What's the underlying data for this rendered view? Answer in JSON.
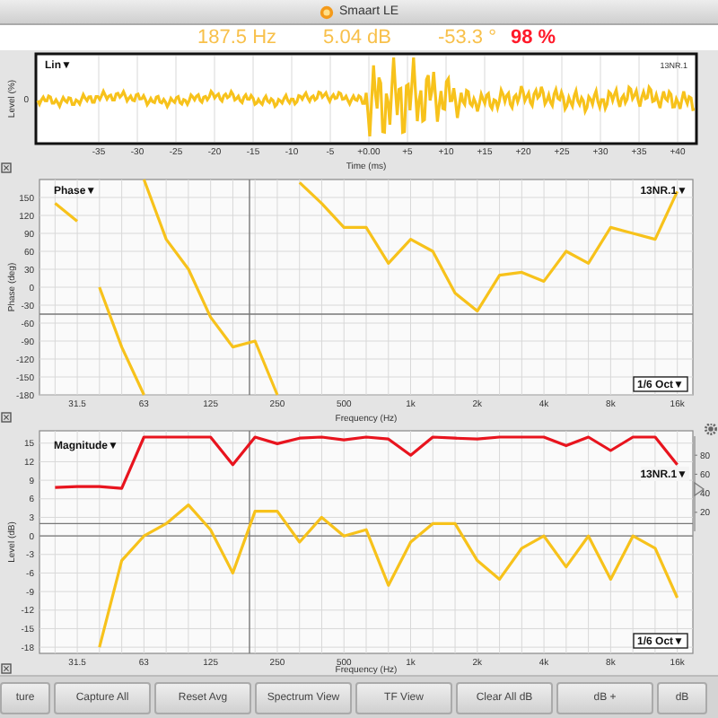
{
  "window": {
    "title": "Smaart LE"
  },
  "readouts": [
    {
      "text": "187.5 Hz",
      "color": "#f8c04a"
    },
    {
      "text": "5.04 dB",
      "color": "#f8c04a"
    },
    {
      "text": "-53.3 °",
      "color": "#f8c04a"
    },
    {
      "text": "98 %",
      "color": "#ff1a2a"
    }
  ],
  "time_plot": {
    "mode": "Lin▼",
    "trace_label": "13NR.1",
    "ylabel": "Level (%)",
    "yticks": [
      "0"
    ],
    "xlabel": "Time (ms)",
    "xticks": [
      "-35",
      "-30",
      "-25",
      "-20",
      "-15",
      "-10",
      "-5",
      "+0.00",
      "+5",
      "+10",
      "+15",
      "+20",
      "+25",
      "+30",
      "+35",
      "+40"
    ]
  },
  "phase_plot": {
    "mode": "Phase▼",
    "trace_label": "13NR.1▼",
    "smoothing": "1/6 Oct▼",
    "chart_data": {
      "type": "line",
      "xlabel": "Frequency (Hz)",
      "ylabel": "Phase (deg)",
      "categories": [
        null,
        "31.5",
        null,
        null,
        "63",
        null,
        null,
        "125",
        null,
        null,
        "250",
        null,
        null,
        "500",
        null,
        null,
        "1k",
        null,
        null,
        "2k",
        null,
        null,
        "4k",
        null,
        null,
        "8k",
        null,
        null,
        "16k"
      ],
      "series": [
        {
          "color": "#f7c21b",
          "values": [
            140,
            110,
            null,
            null,
            null,
            null,
            null,
            null,
            null,
            null,
            null,
            null,
            null,
            null,
            null,
            null,
            null,
            null,
            null,
            null,
            null,
            null,
            null,
            null,
            null,
            null,
            null,
            null,
            null
          ]
        },
        {
          "color": "#f7c21b",
          "values": [
            null,
            null,
            0,
            -100,
            -180,
            null,
            null,
            null,
            null,
            null,
            null,
            null,
            null,
            null,
            null,
            null,
            null,
            null,
            null,
            null,
            null,
            null,
            null,
            null,
            null,
            null,
            null,
            null,
            null
          ]
        },
        {
          "color": "#f7c21b",
          "values": [
            null,
            null,
            null,
            null,
            180,
            80,
            30,
            -50,
            -100,
            -90,
            -180,
            null,
            null,
            null,
            null,
            null,
            null,
            null,
            null,
            null,
            null,
            null,
            null,
            null,
            null,
            null,
            null,
            null,
            null
          ]
        },
        {
          "color": "#f7c21b",
          "values": [
            null,
            null,
            null,
            null,
            null,
            null,
            null,
            null,
            null,
            null,
            null,
            175,
            140,
            100,
            100,
            40,
            80,
            60,
            -10,
            -40,
            20,
            25,
            10,
            60,
            40,
            100,
            90,
            80,
            160
          ]
        }
      ],
      "ylim": [
        -180,
        180
      ],
      "grid": true,
      "ref_lines": [
        {
          "axis": "y",
          "value": -45
        }
      ],
      "yticks": [
        150,
        120,
        90,
        60,
        30,
        0,
        -30,
        -60,
        -90,
        -120,
        -150,
        -180
      ]
    }
  },
  "magnitude_plot": {
    "mode": "Magnitude▼",
    "trace_label": "13NR.1▼",
    "smoothing": "1/6 Oct▼",
    "chart_data": {
      "type": "line",
      "xlabel": "Frequency (Hz)",
      "ylabel": "Level (dB)",
      "categories": [
        null,
        "31.5",
        null,
        null,
        "63",
        null,
        null,
        "125",
        null,
        null,
        "250",
        null,
        null,
        "500",
        null,
        null,
        "1k",
        null,
        null,
        "2k",
        null,
        null,
        "4k",
        null,
        null,
        "8k",
        null,
        null,
        "16k"
      ],
      "series": [
        {
          "color": "#f7c21b",
          "values": [
            null,
            null,
            -18,
            -4,
            0,
            2,
            5,
            1,
            -6,
            4,
            4,
            -1,
            3,
            0,
            1,
            -8,
            -1,
            2,
            2,
            -4,
            -7,
            -2,
            0,
            -5,
            0,
            -7,
            0,
            -2,
            -10
          ]
        }
      ],
      "ylim": [
        -19,
        17
      ],
      "grid": true,
      "ref_lines": [
        {
          "axis": "y",
          "value": 2
        },
        {
          "axis": "y",
          "value": 0
        }
      ],
      "yticks": [
        15,
        12,
        9,
        6,
        3,
        0,
        -3,
        -6,
        -9,
        -12,
        -15,
        -18
      ]
    },
    "coherence": {
      "chart_data": {
        "type": "line",
        "series": [
          {
            "color": "#e8141e",
            "values": [
              46,
              47,
              47,
              45,
              99,
              99,
              99,
              99,
              70,
              99,
              92,
              98,
              99,
              96,
              99,
              97,
              80,
              99,
              98,
              97,
              99,
              99,
              99,
              90,
              99,
              85,
              99,
              99,
              70
            ]
          }
        ],
        "ylim": [
          0,
          100
        ],
        "yticks": [
          80,
          60,
          40,
          20
        ]
      }
    }
  },
  "buttons": [
    "ture",
    "Capture All",
    "Reset Avg",
    "Spectrum View",
    "TF View",
    "Clear All dB",
    "dB +",
    "dB"
  ]
}
